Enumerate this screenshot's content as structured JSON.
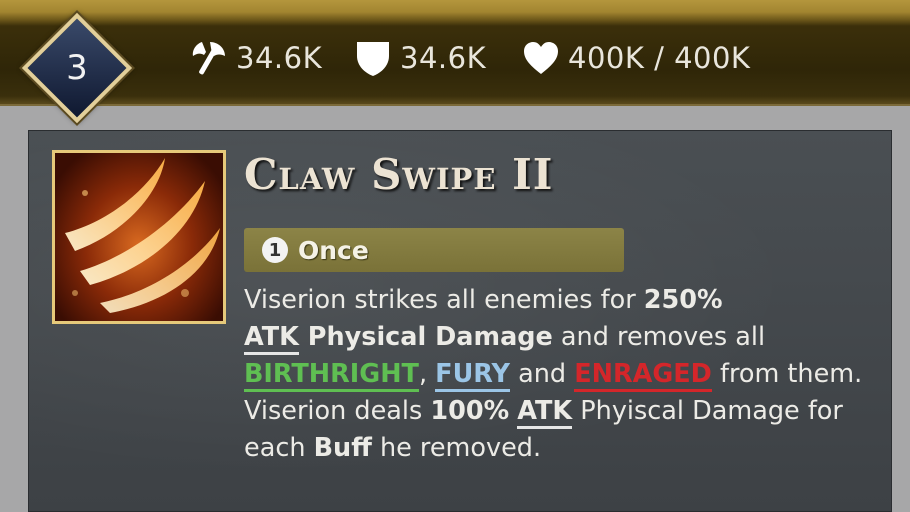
{
  "header": {
    "level": "3",
    "attack": "34.6K",
    "defense": "34.6K",
    "health": "400K / 400K",
    "icons": [
      "axe-icon",
      "shield-icon",
      "heart-icon"
    ]
  },
  "skill": {
    "title": "Claw Swipe II",
    "tag_number": "1",
    "tag_label": "Once",
    "desc": {
      "t1": "Viserion strikes all enemies for ",
      "b1": "250%",
      "u1": "ATK",
      "b2": " Physical Damage",
      "t2": " and removes all ",
      "k1": "BIRTHRIGHT",
      "t3": ", ",
      "k2": "FURY",
      "t4": " and ",
      "k3": "ENRAGED",
      "t5": " from them. Viserion deals ",
      "b3": "100%",
      "t6": " ",
      "u2": "ATK",
      "t7": " Phyiscal Damage for each ",
      "b4": "Buff",
      "t8": " he removed."
    }
  },
  "colors": {
    "gold_frame": "#e6c97a",
    "tag_bg": "#8c8447",
    "keyword_green": "#5fbf52",
    "keyword_blue": "#9bc5e6",
    "keyword_red": "#d4262a"
  }
}
